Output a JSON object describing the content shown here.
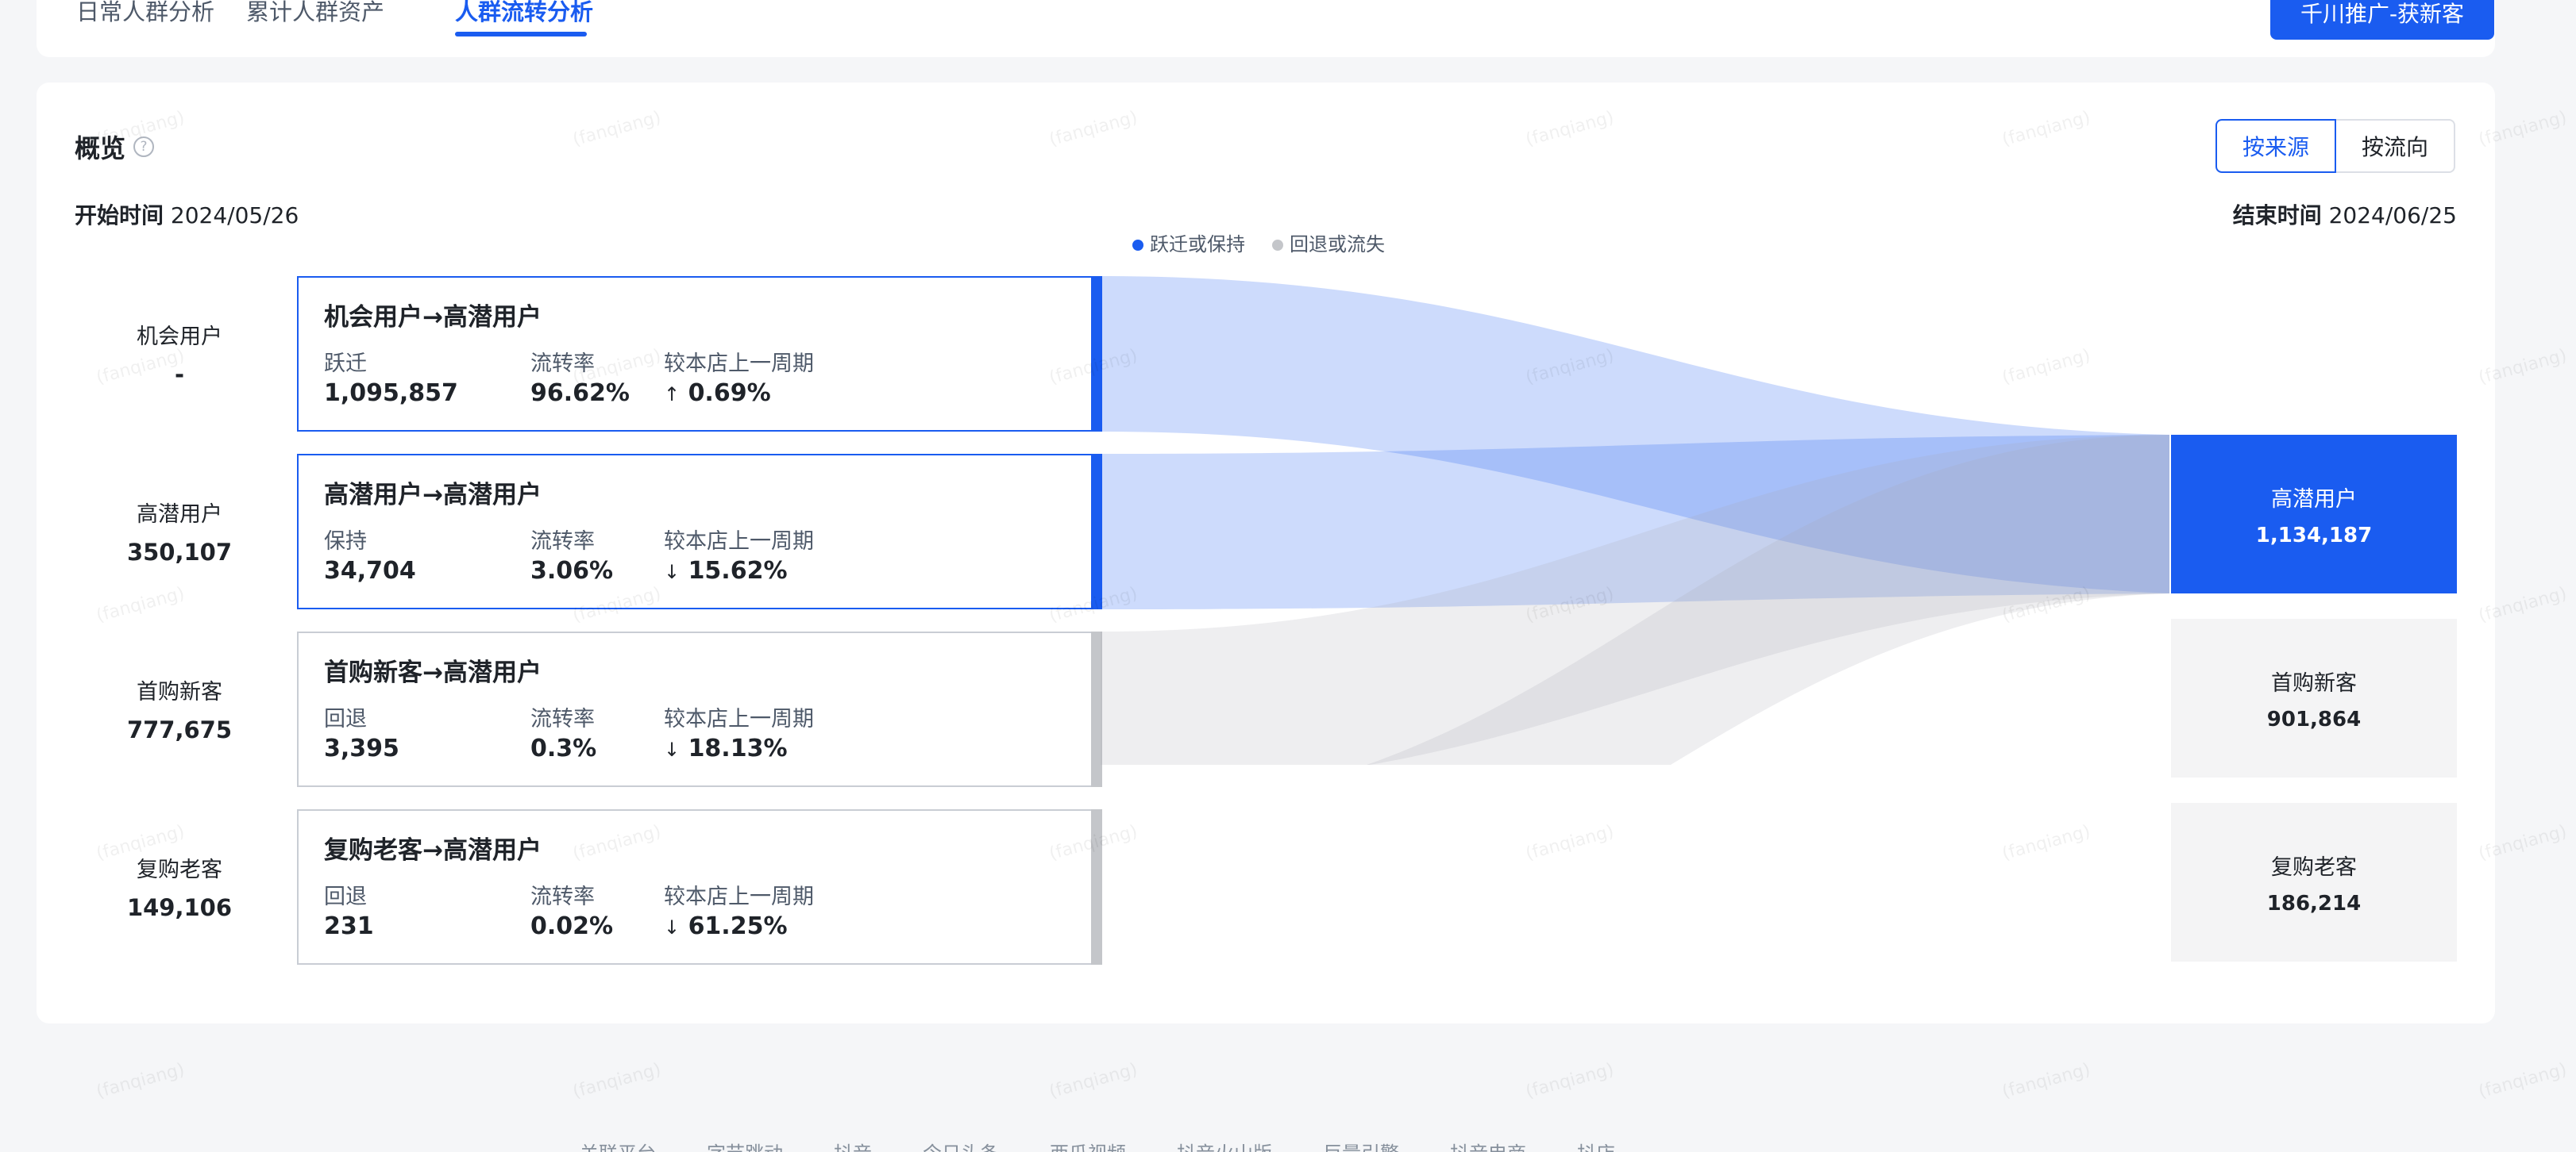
{
  "tabs": [
    "日常人群分析",
    "累计人群资产",
    "人群流转分析"
  ],
  "promo_button": "千川推广-获新客",
  "overview": {
    "title": "概览",
    "help_icon": "?",
    "toggle": [
      "按来源",
      "按流向"
    ],
    "start_label": "开始时间",
    "start_date": "2024/05/26",
    "end_label": "结束时间",
    "end_date": "2024/06/25"
  },
  "legend": [
    {
      "label": "跃迁或保持",
      "color": "#1a5cf0"
    },
    {
      "label": "回退或流失",
      "color": "#c4c6ca"
    }
  ],
  "sources": [
    {
      "name": "机会用户",
      "value": "-"
    },
    {
      "name": "高潜用户",
      "value": "350,107"
    },
    {
      "name": "首购新客",
      "value": "777,675"
    },
    {
      "name": "复购老客",
      "value": "149,106"
    }
  ],
  "flows": [
    {
      "title": "机会用户→高潜用户",
      "kind": "跃迁",
      "count": "1,095,857",
      "rate_label": "流转率",
      "rate": "96.62%",
      "cmp_label": "较本店上一周期",
      "cmp_arrow": "↑",
      "cmp": "0.69%",
      "trend": "up",
      "style": "blue"
    },
    {
      "title": "高潜用户→高潜用户",
      "kind": "保持",
      "count": "34,704",
      "rate_label": "流转率",
      "rate": "3.06%",
      "cmp_label": "较本店上一周期",
      "cmp_arrow": "↓",
      "cmp": "15.62%",
      "trend": "down",
      "style": "blue"
    },
    {
      "title": "首购新客→高潜用户",
      "kind": "回退",
      "count": "3,395",
      "rate_label": "流转率",
      "rate": "0.3%",
      "cmp_label": "较本店上一周期",
      "cmp_arrow": "↓",
      "cmp": "18.13%",
      "trend": "down",
      "style": "grey"
    },
    {
      "title": "复购老客→高潜用户",
      "kind": "回退",
      "count": "231",
      "rate_label": "流转率",
      "rate": "0.02%",
      "cmp_label": "较本店上一周期",
      "cmp_arrow": "↓",
      "cmp": "61.25%",
      "trend": "down",
      "style": "grey"
    }
  ],
  "targets": [
    {
      "name": "高潜用户",
      "value": "1,134,187",
      "style": "blue"
    },
    {
      "name": "首购新客",
      "value": "901,864",
      "style": "grey"
    },
    {
      "name": "复购老客",
      "value": "186,214",
      "style": "grey"
    }
  ],
  "footer_links": [
    "关联平台",
    "字节跳动",
    "抖音",
    "今日头条",
    "西瓜视频",
    "抖音火山版",
    "巨量引擎",
    "抖音电商",
    "抖店"
  ],
  "watermark": "(fanqiang)"
}
